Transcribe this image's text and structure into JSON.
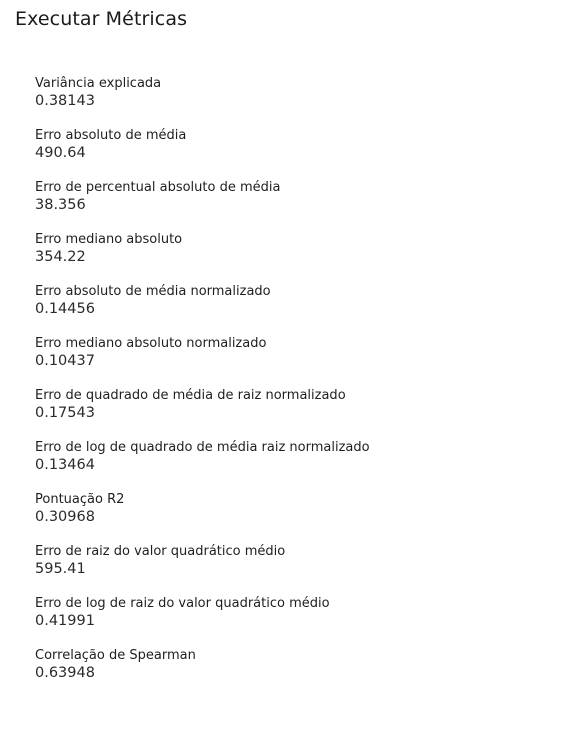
{
  "panel": {
    "title": "Executar Métricas"
  },
  "metrics": [
    {
      "label": "Variância explicada",
      "value": "0.38143"
    },
    {
      "label": "Erro absoluto de média",
      "value": "490.64"
    },
    {
      "label": "Erro de percentual absoluto de média",
      "value": "38.356"
    },
    {
      "label": "Erro mediano absoluto",
      "value": "354.22"
    },
    {
      "label": "Erro absoluto de média normalizado",
      "value": "0.14456"
    },
    {
      "label": "Erro mediano absoluto normalizado",
      "value": "0.10437"
    },
    {
      "label": "Erro de quadrado de média de raiz normalizado",
      "value": "0.17543"
    },
    {
      "label": "Erro de log de quadrado de média raiz normalizado",
      "value": "0.13464"
    },
    {
      "label": "Pontuação R2",
      "value": "0.30968"
    },
    {
      "label": "Erro de raiz do valor quadrático médio",
      "value": "595.41"
    },
    {
      "label": "Erro de log de raiz do valor quadrático médio",
      "value": "0.41991"
    },
    {
      "label": "Correlação de Spearman",
      "value": "0.63948"
    }
  ]
}
